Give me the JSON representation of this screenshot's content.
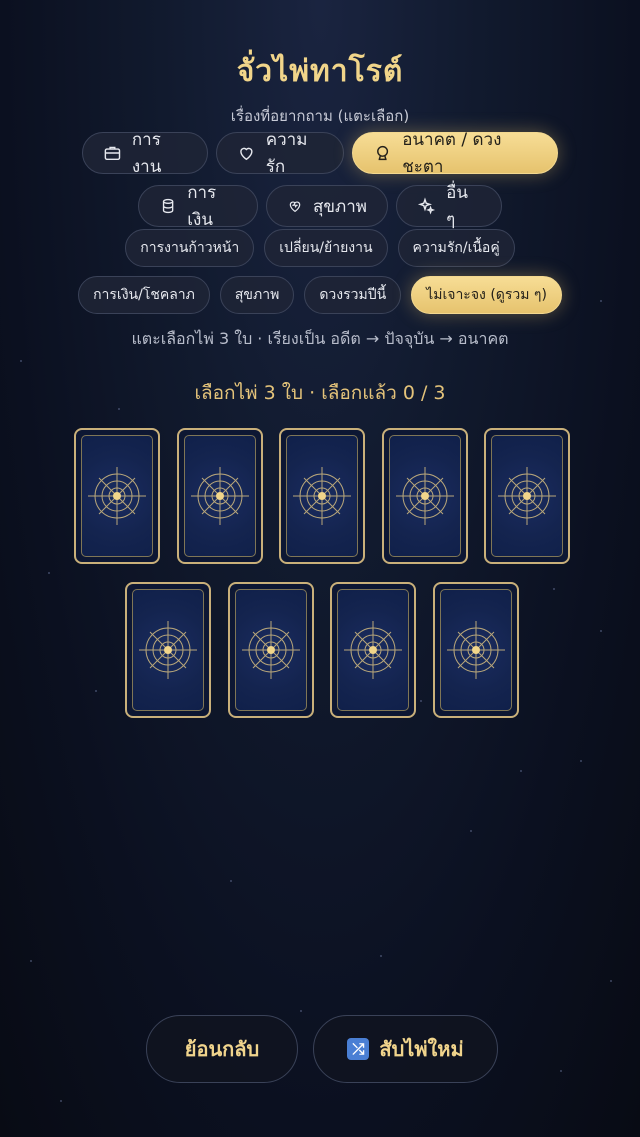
{
  "header": {
    "title": "จั่วไพ่ทาโรต์",
    "subtitle": "เรื่องที่อยากถาม (แตะเลือก)"
  },
  "topics": [
    {
      "label": "การงาน",
      "icon": "briefcase-icon"
    },
    {
      "label": "ความรัก",
      "icon": "heart-icon"
    },
    {
      "label": "อนาคต / ดวงชะตา",
      "icon": "crystal-ball-icon",
      "active": true
    },
    {
      "label": "การเงิน",
      "icon": "coins-icon"
    },
    {
      "label": "สุขภาพ",
      "icon": "heart-pulse-icon"
    },
    {
      "label": "อื่น ๆ",
      "icon": "sparkles-icon"
    }
  ],
  "subtopics": [
    {
      "label": "การงานก้าวหน้า"
    },
    {
      "label": "เปลี่ยน/ย้ายงาน"
    },
    {
      "label": "ความรัก/เนื้อคู่"
    },
    {
      "label": "การเงิน/โชคลาภ"
    },
    {
      "label": "สุขภาพ"
    },
    {
      "label": "ดวงรวมปีนี้"
    },
    {
      "label": "ไม่เจาะจง (ดูรวม ๆ)",
      "active": true
    }
  ],
  "instruction": "แตะเลือกไพ่ 3 ใบ · เรียงเป็น อดีต → ปัจจุบัน → อนาคต",
  "counter": "เลือกไพ่ 3 ใบ · เลือกแล้ว 0 / 3",
  "selection": {
    "selected": 0,
    "required": 3,
    "cards_shown": 9
  },
  "buttons": {
    "back": "ย้อนกลับ",
    "shuffle": "สับไพ่ใหม่",
    "shuffle_icon": "shuffle-icon"
  },
  "colors": {
    "accent": "#f1d58a",
    "active_pill": "#f0d28a",
    "card_back": "#14244f",
    "card_border": "#c9b07a"
  }
}
